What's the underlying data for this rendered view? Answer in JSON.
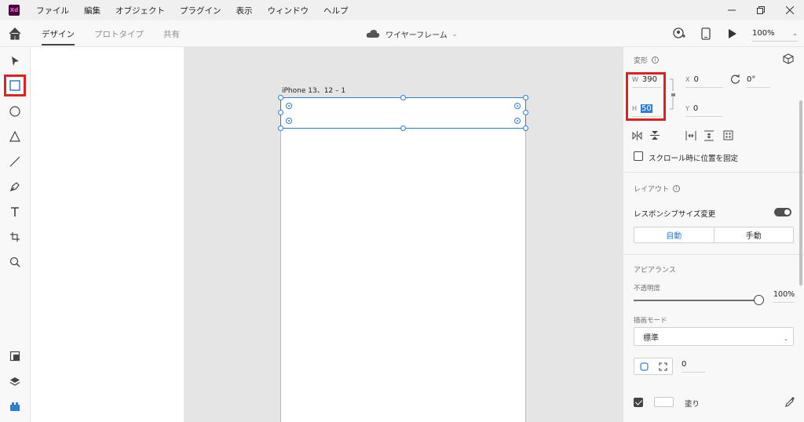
{
  "app": {
    "logo_text": "Xd",
    "brand_color": "#470137"
  },
  "menu": [
    "ファイル",
    "編集",
    "オブジェクト",
    "プラグイン",
    "表示",
    "ウィンドウ",
    "ヘルプ"
  ],
  "tabs": [
    {
      "label": "デザイン",
      "active": true
    },
    {
      "label": "プロトタイプ",
      "active": false
    },
    {
      "label": "共有",
      "active": false
    }
  ],
  "document": {
    "title": "ワイヤーフレーム",
    "caret": "⌄"
  },
  "zoom": {
    "value": "100%",
    "chevron": "⌄"
  },
  "canvas": {
    "artboard_label": "iPhone 13、12 – 1"
  },
  "transform": {
    "title": "変形",
    "w_label": "W",
    "w_value": "390",
    "h_label": "H",
    "h_value": "50",
    "x_label": "X",
    "x_value": "0",
    "y_label": "Y",
    "y_value": "0",
    "rotation": "0°",
    "fix_scroll_label": "スクロール時に位置を固定"
  },
  "layout": {
    "title": "レイアウト",
    "responsive_label": "レスポンシブサイズ変更",
    "responsive_on": true,
    "auto_label": "自動",
    "manual_label": "手動"
  },
  "appearance": {
    "title": "アピアランス",
    "opacity_label": "不透明度",
    "opacity_value": "100%",
    "blend_label": "描画モード",
    "blend_value": "標準",
    "corner_value": "0",
    "fill_label": "塗り",
    "fill_checked": true,
    "fill_color": "#ffffff"
  },
  "colors": {
    "accent": "#2d7fd6",
    "highlight_box": "#e02121"
  }
}
